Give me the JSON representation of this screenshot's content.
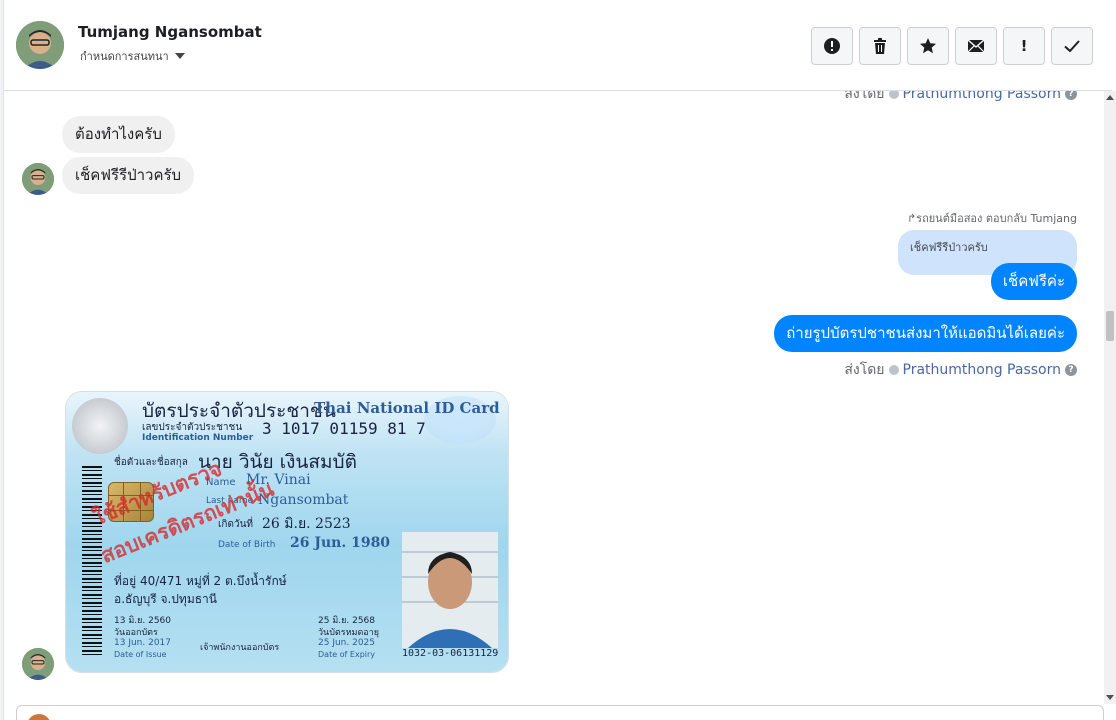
{
  "header": {
    "name": "Tumjang Ngansombat",
    "subtitle": "กำหนดการสนทนา"
  },
  "toolbar": {
    "icons": [
      "alert-icon",
      "trash-icon",
      "star-icon",
      "envelope-icon",
      "exclamation-icon",
      "check-icon"
    ],
    "exclamation": "!"
  },
  "messages": {
    "sent_by_prefix": "ส่งโดย",
    "sender": "Prathumthong Passorn",
    "incoming_1": "ต้องทำไงครับ",
    "incoming_2": "เช็คฟรีรีป่าวครับ",
    "reply_label": "รถยนต์มือสอง ตอบกลับ Tumjang",
    "quoted_text": "เช็คฟรีรีป่าวครับ",
    "outgoing_1": "เช็คฟรีค่ะ",
    "outgoing_2": "ถ่ายรูปบัตรปชาชนส่งมาให้แอดมินได้เลยค่ะ"
  },
  "id_card": {
    "title_th": "บัตรประจำตัวประชาชน",
    "title_en": "Thai National ID Card",
    "id_label_th": "เลขประจำตัวประชาชน",
    "id_label_en": "Identification Number",
    "id_number": "3 1017 01159 81 7",
    "name_label_th": "ชื่อตัวและชื่อสกุล",
    "name_th": "นาย วินัย  เงินสมบัติ",
    "name_label_en": "Name",
    "name_en": "Mr. Vinai",
    "last_label_en": "Last name",
    "last_en": "Ngansombat",
    "dob_label_th": "เกิดวันที่",
    "dob_th": "26 มิ.ย. 2523",
    "dob_label_en": "Date of Birth",
    "dob_en": "26 Jun. 1980",
    "address_1": "ที่อยู่ 40/471 หมู่ที่ 2 ต.บึงน้ำรักษ์",
    "address_2": "อ.ธัญบุรี จ.ปทุมธานี",
    "issue_th": "13 มิ.ย. 2560",
    "issue_label_th": "วันออกบัตร",
    "issue_en": "13 Jun. 2017",
    "issue_label_en": "Date of Issue",
    "expiry_th": "25 มิ.ย. 2568",
    "expiry_label_th": "วันบัตรหมดอายุ",
    "expiry_en": "25 Jun. 2025",
    "expiry_label_en": "Date of Expiry",
    "officer": "เจ้าพนักงานออกบัตร",
    "serial": "1032-03-06131129",
    "stamp_1": "ใช้สำหรับตรวจ",
    "stamp_2": "สอบเครดิตรถเท่านั้น"
  },
  "colors": {
    "accent": "#0084ff",
    "sender_link": "#4b67a1",
    "bubble_in": "#f1f0f0",
    "quote_bg": "#cfe4fc"
  }
}
